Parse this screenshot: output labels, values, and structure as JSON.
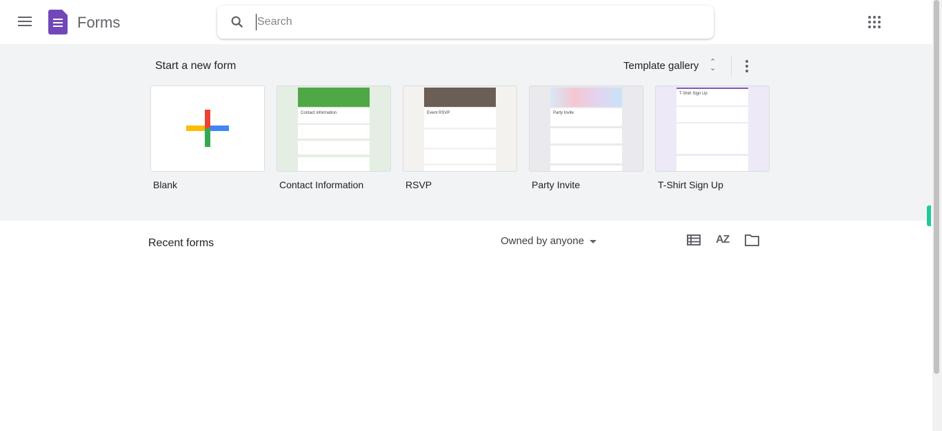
{
  "header": {
    "app_name": "Forms",
    "search_placeholder": "Search"
  },
  "templates": {
    "section_title": "Start a new form",
    "gallery_label": "Template gallery",
    "items": [
      {
        "label": "Blank"
      },
      {
        "label": "Contact Information",
        "preview_title": "Contact information",
        "bg": "#e4eee2",
        "banner": "#4fa845"
      },
      {
        "label": "RSVP",
        "preview_title": "Event RSVP",
        "bg": "#f3f2ef",
        "banner": "#6a5e55"
      },
      {
        "label": "Party Invite",
        "preview_title": "Party Invite",
        "bg": "#e9e9ee",
        "banner": "#c9b9d8"
      },
      {
        "label": "T-Shirt Sign Up",
        "preview_title": "T-Shirt Sign Up",
        "bg": "#ede9f6",
        "banner": "#7b5fb7"
      }
    ]
  },
  "recent": {
    "title": "Recent forms",
    "owner_filter": "Owned by anyone"
  },
  "colors": {
    "brand": "#7248b9",
    "band": "#f1f3f4"
  }
}
